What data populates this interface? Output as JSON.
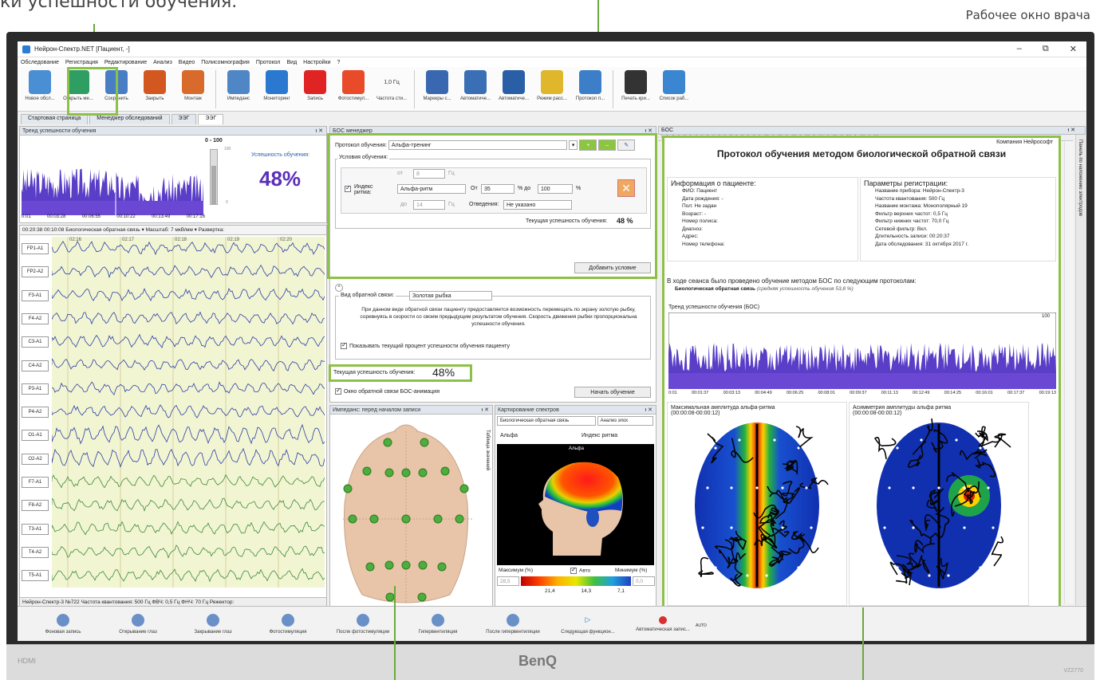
{
  "captions": {
    "top_left": "ки успешности обучения.",
    "top_right": "Рабочее окно врача"
  },
  "window": {
    "title": "Нейрон-Спектр.NET [Пациент, -]",
    "min": "–",
    "max": "⧉",
    "close": "✕"
  },
  "menu": [
    "Обследование",
    "Регистрация",
    "Редактирование",
    "Анализ",
    "Видео",
    "Полисомнография",
    "Протокол",
    "Вид",
    "Настройки",
    "?"
  ],
  "toolbar": [
    {
      "label": "Новое обсл...",
      "icon": "new-exam-icon",
      "color": "#4a8fd4"
    },
    {
      "label": "Открыть ме...",
      "icon": "open-icon",
      "color": "#2f9e62"
    },
    {
      "label": "Сохранить",
      "icon": "save-icon",
      "color": "#4a7ec4"
    },
    {
      "label": "Закрыть",
      "icon": "close-exam-icon",
      "color": "#d2581f"
    },
    {
      "label": "Монтаж",
      "icon": "montage-icon",
      "color": "#d86b2b"
    },
    {
      "label": "Импеданс",
      "icon": "impedance-icon",
      "color": "#4f86c6"
    },
    {
      "label": "Мониторинг",
      "icon": "play-icon",
      "color": "#2a78d0"
    },
    {
      "label": "Запись",
      "icon": "record-icon",
      "color": "#e02424"
    },
    {
      "label": "Фотостимул...",
      "icon": "photostim-icon",
      "color": "#e84a2a"
    },
    {
      "label": "Частота сти...",
      "icon": "freq-icon",
      "color": "#bbbbbb",
      "text": "1,0 Гц"
    },
    {
      "label": "Маркеры с...",
      "icon": "markers-icon",
      "color": "#3a68b0"
    },
    {
      "label": "Автоматиче...",
      "icon": "auto1-icon",
      "color": "#3a6fb5"
    },
    {
      "label": "Автоматиче...",
      "icon": "auto2-icon",
      "color": "#2a5fa8"
    },
    {
      "label": "Режим расс...",
      "icon": "mode-icon",
      "color": "#e0b62a"
    },
    {
      "label": "Протокол п...",
      "icon": "protocol-icon",
      "color": "#3c7fc8"
    },
    {
      "label": "Печать кри...",
      "icon": "print-icon",
      "color": "#333333"
    },
    {
      "label": "Список раб...",
      "icon": "list-icon",
      "color": "#3a86d0"
    }
  ],
  "tabs": [
    "Стартовая страница",
    "Менеджер обследований",
    "ЭЭГ",
    "ЭЭГ"
  ],
  "trend": {
    "title": "Тренд успешности обучения",
    "range": "0 - 100",
    "scale_top": "100",
    "scale_bot": "0",
    "pct_top": "48%",
    "success_label": "Успешность обучения:",
    "success_value": "48%",
    "times": [
      "0:01",
      "00:03:28",
      "00:06:55",
      "00:10:22",
      "00:13:49",
      "00:17:16"
    ]
  },
  "eeg": {
    "toolbar": "00:20:38  00:10:08 Биологическая обратная связь  ▾  Масштаб: 7 мкВ/мм  ▾  Развертка:",
    "time_marks": [
      "02:16",
      "02:17",
      "02:18",
      "02:19",
      "02:20"
    ],
    "channels": [
      "FP1-A1",
      "FP2-A2",
      "F3-A1",
      "F4-A2",
      "C3-A1",
      "C4-A2",
      "P3-A1",
      "P4-A2",
      "O1-A1",
      "O2-A2",
      "F7-A1",
      "F8-A2",
      "T3-A1",
      "T4-A2",
      "T5-A1"
    ],
    "status": "Нейрон-Спектр-3 №722  Частота квантования: 500 Гц  ФВЧ: 0,5 Гц  ФНЧ: 70 Гц  Режектор:"
  },
  "bos": {
    "title": "БОС менеджер",
    "protocol_label": "Протокол обучения:",
    "protocol_value": "Альфа-тренинг",
    "conditions_label": "Условия обучения:",
    "from_label": "от",
    "from_val": "8",
    "hz": "Гц",
    "index_label": "Индекс ритма:",
    "rhythm": "Альфа-ритм",
    "ot": "От",
    "val1": "35",
    "pct_to": "% до",
    "val2": "100",
    "pct": "%",
    "to_label": "до",
    "to_val": "14",
    "lead_label": "Отведения:",
    "lead_val": "Не указано",
    "current_small": "Текущая успешность обучения:",
    "current_small_val": "48 %",
    "add_cond": "Добавить условие",
    "fb_label": "Вид обратной связи:",
    "fb_value": "Золотая рыбка",
    "fb_desc": "При данном виде обратной связи пациенту предоставляется возможность перемещать по экрану золотую рыбку, соревнуясь в скорости со своим предыдущим результатом обучения. Скорость движения рыбки пропорциональна успешности обучения.",
    "show_pct": "Показывать текущий процент успешности обучения пациенту",
    "current_big": "Текущая успешность обучения:",
    "current_big_val": "48%",
    "window_anim": "Окно обратной связи БОС-анимация",
    "start": "Начать обучение"
  },
  "impedance": {
    "title": "Импеданс: перед началом записи",
    "side": "Таблица значений"
  },
  "spectra": {
    "title": "Картирование спектров",
    "mode": "Биологическая обратная связь",
    "analysis": "Анализ эпох",
    "band": "Альфа",
    "index": "Индекс ритма",
    "head_label": "Альфа",
    "max_label": "Максимум (%)",
    "auto": "Авто",
    "min_label": "Минимум (%)",
    "max_val": "28,5",
    "min_val": "0,0",
    "scale": [
      "21,4",
      "14,3",
      "7,1"
    ]
  },
  "report": {
    "panel_title": "БОС",
    "company": "Компания Нейрософт",
    "title": "Протокол обучения методом биологической обратной связи",
    "patient_head": "Информация о пациенте:",
    "patient": [
      "ФИО: Пациент",
      "Дата рождения: -",
      "Пол: Не задан",
      "Возраст: -",
      "Номер полиса:",
      "Диагноз:",
      "Адрес:",
      "Номер телефона:"
    ],
    "reg_head": "Параметры регистрации:",
    "reg": [
      "Название прибора: Нейрон-Спектр-3",
      "Частота квантования: 500 Гц",
      "Название монтажа: Монополярный 19",
      "Фильтр верхних частот: 0,5 Гц",
      "Фильтр нижних частот: 70,0 Гц",
      "Сетевой фильтр: Вкл.",
      "Длительность записи: 00:20:37",
      "Дата обследования: 31 октября 2017 г."
    ],
    "session": "В ходе сеанса было проведено обучение методом БОС по следующим протоколам:",
    "session_bold": "Биологическая обратная связь",
    "session_ital": "(средняя успешность обучения 53,8 %)",
    "trend_title": "Тренд успешности обучения (БОС)",
    "trend_max": "100",
    "trend_times": [
      "0:01",
      "00:01:37",
      "00:03:13",
      "00:04:49",
      "00:06:25",
      "00:08:01",
      "00:09:37",
      "00:11:13",
      "00:12:49",
      "00:14:25",
      "00:16:01",
      "00:17:37",
      "00:19:13"
    ],
    "map1_title": "Максимальная амплитуда альфа-ритма",
    "map1_time": "(00:00:08-00:00:12)",
    "map2_title": "Асимметрия амплитуды альфа ритма",
    "map2_time": "(00:00:08-00:00:12)",
    "side_tab": "Панель по наложению электродов"
  },
  "bottom": [
    "Фоновая запись",
    "Открывание глаз",
    "Закрывание глаз",
    "Фотостимуляция",
    "После фотостимуляции",
    "Гипервентиляция",
    "После гипервентиляции",
    "Следующая функцион...",
    "Автоматическая запис..."
  ],
  "auto_label": "AUTO",
  "monitor": {
    "brand": "BenQ",
    "hdmi": "HDMI",
    "model": "VZ2770"
  }
}
